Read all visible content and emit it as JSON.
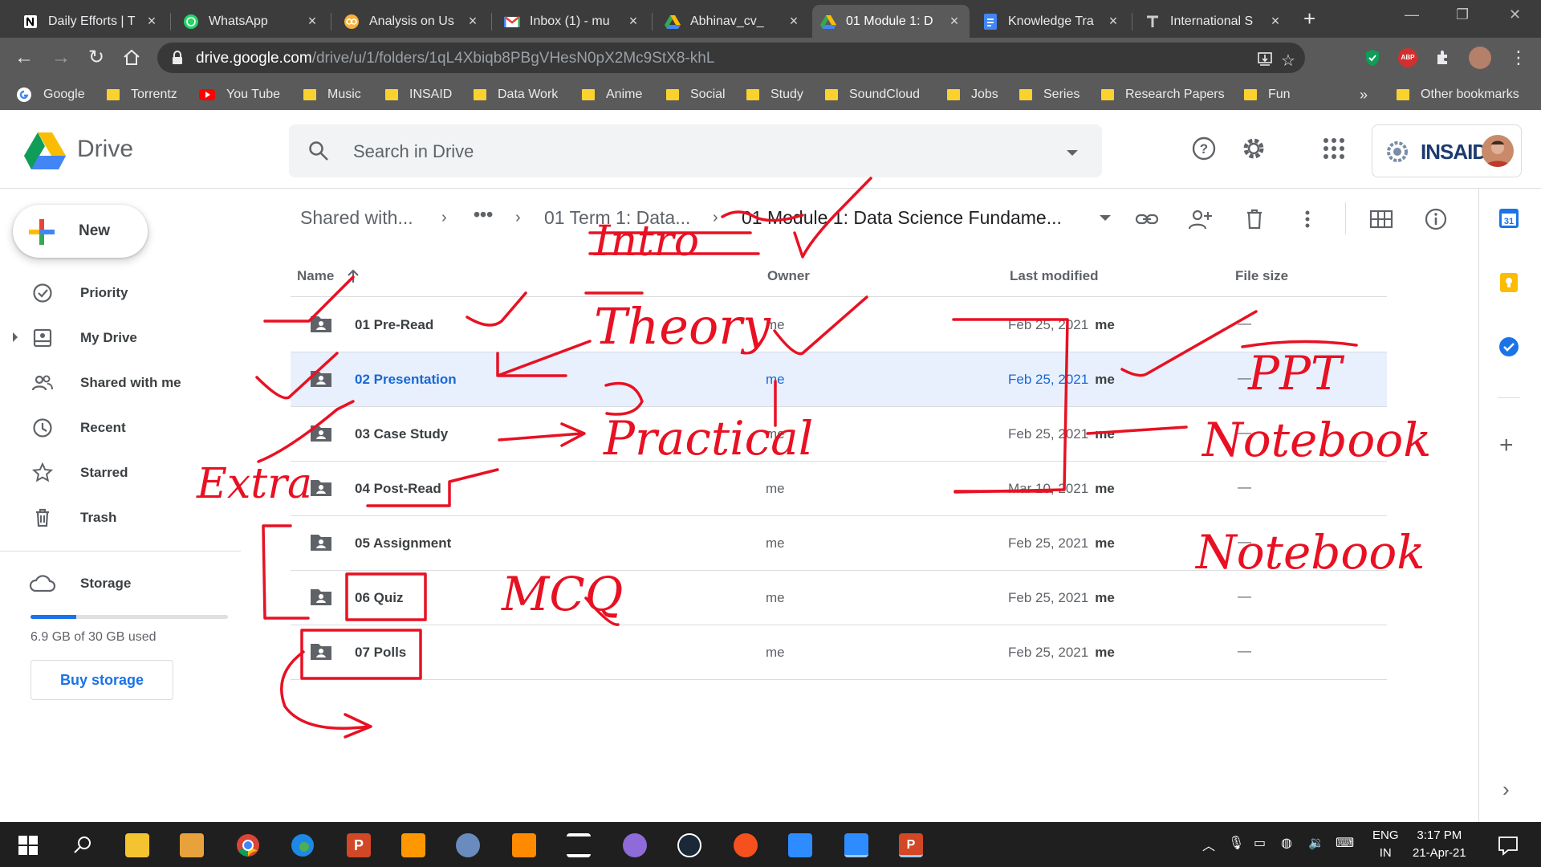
{
  "browser": {
    "tabs": [
      {
        "title": "Daily Efforts | T",
        "icon": "notion-icon",
        "active": false
      },
      {
        "title": "WhatsApp",
        "icon": "whatsapp-icon",
        "active": false
      },
      {
        "title": "Analysis on Us",
        "icon": "analysis-icon",
        "active": false
      },
      {
        "title": "Inbox (1) - mu",
        "icon": "gmail-icon",
        "active": false
      },
      {
        "title": "Abhinav_cv_",
        "icon": "drive-icon",
        "active": false
      },
      {
        "title": "01 Module 1: D",
        "icon": "drive-icon",
        "active": true
      },
      {
        "title": "Knowledge Tra",
        "icon": "docs-icon",
        "active": false
      },
      {
        "title": "International S",
        "icon": "news-icon",
        "active": false
      }
    ],
    "url_host": "drive.google.com",
    "url_path": "/drive/u/1/folders/1qL4Xbiqb8PBgVHesN0pX2Mc9StX8-khL",
    "bookmarks": [
      {
        "label": "Google",
        "type": "google"
      },
      {
        "label": "Torrentz",
        "type": "folder"
      },
      {
        "label": "You Tube",
        "type": "youtube"
      },
      {
        "label": "Music",
        "type": "folder"
      },
      {
        "label": "INSAID",
        "type": "folder"
      },
      {
        "label": "Data Work",
        "type": "folder"
      },
      {
        "label": "Anime",
        "type": "folder"
      },
      {
        "label": "Social",
        "type": "folder"
      },
      {
        "label": "Study",
        "type": "folder"
      },
      {
        "label": "SoundCloud",
        "type": "folder"
      },
      {
        "label": "Jobs",
        "type": "folder"
      },
      {
        "label": "Series",
        "type": "folder"
      },
      {
        "label": "Research Papers",
        "type": "folder"
      },
      {
        "label": "Fun",
        "type": "folder"
      }
    ],
    "bookmarks_overflow": "»",
    "other_bookmarks": "Other bookmarks"
  },
  "drive": {
    "brand": "Drive",
    "search_placeholder": "Search in Drive",
    "org_name": "INSAID",
    "new_label": "New",
    "nav": [
      {
        "label": "Priority",
        "icon": "priority-icon"
      },
      {
        "label": "My Drive",
        "icon": "my-drive-icon"
      },
      {
        "label": "Shared with me",
        "icon": "shared-icon"
      },
      {
        "label": "Recent",
        "icon": "clock-icon"
      },
      {
        "label": "Starred",
        "icon": "star-icon"
      },
      {
        "label": "Trash",
        "icon": "trash-icon"
      }
    ],
    "storage_label": "Storage",
    "storage_used_text": "6.9 GB of 30 GB used",
    "storage_fraction": 0.23,
    "buy_storage": "Buy storage",
    "breadcrumb": {
      "root": "Shared with...",
      "ellipsis": "•••",
      "parent": "01 Term 1: Data...",
      "current": "01 Module 1: Data Science Fundame..."
    },
    "columns": {
      "name": "Name",
      "owner": "Owner",
      "modified": "Last modified",
      "size": "File size"
    },
    "files": [
      {
        "name": "01 Pre-Read",
        "owner": "me",
        "modified": "Feb 25, 2021",
        "modified_by": "me",
        "size": "—"
      },
      {
        "name": "02 Presentation",
        "owner": "me",
        "modified": "Feb 25, 2021",
        "modified_by": "me",
        "size": "—"
      },
      {
        "name": "03 Case Study",
        "owner": "me",
        "modified": "Feb 25, 2021",
        "modified_by": "me",
        "size": "—"
      },
      {
        "name": "04 Post-Read",
        "owner": "me",
        "modified": "Mar 10, 2021",
        "modified_by": "me",
        "size": "—"
      },
      {
        "name": "05 Assignment",
        "owner": "me",
        "modified": "Feb 25, 2021",
        "modified_by": "me",
        "size": "—"
      },
      {
        "name": "06 Quiz",
        "owner": "me",
        "modified": "Feb 25, 2021",
        "modified_by": "me",
        "size": "—"
      },
      {
        "name": "07 Polls",
        "owner": "me",
        "modified": "Feb 25, 2021",
        "modified_by": "me",
        "size": "—"
      }
    ],
    "selected_row": 1
  },
  "annotations": {
    "intro": "Intro",
    "theory": "Theory",
    "practical": "Practical",
    "extra": "Extra",
    "mcq": "MCQ",
    "ppt": "PPT",
    "notebook_1": "Notebook",
    "notebook_2": "Notebook"
  },
  "taskbar": {
    "lang_top": "ENG",
    "lang_bottom": "IN",
    "time": "3:17 PM",
    "date": "21-Apr-21"
  },
  "colors": {
    "accent": "#1a73e8",
    "ink": "#e81123",
    "selected_row": "#e8f0fe"
  }
}
